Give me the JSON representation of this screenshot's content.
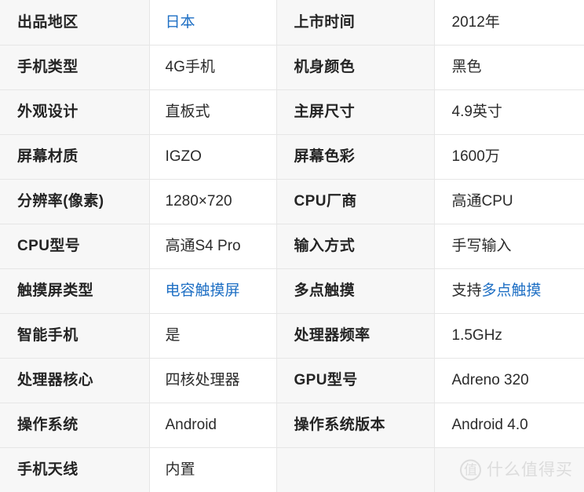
{
  "table": {
    "columns": 4,
    "accent_link_color": "#1e6fc4",
    "label_bg_color": "#f7f7f7",
    "value_bg_color": "#ffffff",
    "border_color": "#e6e6e6",
    "rows": [
      {
        "label_a": "出品地区",
        "value_a": "日本",
        "value_a_link": true,
        "label_b": "上市时间",
        "value_b": "2012年"
      },
      {
        "label_a": "手机类型",
        "value_a": "4G手机",
        "value_a_link": false,
        "label_b": "机身颜色",
        "value_b": "黑色"
      },
      {
        "label_a": "外观设计",
        "value_a": "直板式",
        "value_a_link": false,
        "label_b": "主屏尺寸",
        "value_b": "4.9英寸"
      },
      {
        "label_a": "屏幕材质",
        "value_a": "IGZO",
        "value_a_link": false,
        "label_b": "屏幕色彩",
        "value_b": "1600万"
      },
      {
        "label_a": "分辨率(像素)",
        "value_a": "1280×720",
        "value_a_link": false,
        "label_b": "CPU厂商",
        "value_b": "高通CPU"
      },
      {
        "label_a": "CPU型号",
        "value_a": "高通S4 Pro",
        "value_a_link": false,
        "label_b": "输入方式",
        "value_b": "手写输入"
      },
      {
        "label_a": "触摸屏类型",
        "value_a": "电容触摸屏",
        "value_a_link": true,
        "label_b": "多点触摸",
        "value_b_prefix": "支持",
        "value_b_link_text": "多点触摸"
      },
      {
        "label_a": "智能手机",
        "value_a": "是",
        "value_a_link": false,
        "label_b": "处理器频率",
        "value_b": "1.5GHz"
      },
      {
        "label_a": "处理器核心",
        "value_a": "四核处理器",
        "value_a_link": false,
        "label_b": "GPU型号",
        "value_b": "Adreno 320"
      },
      {
        "label_a": "操作系统",
        "value_a": "Android",
        "value_a_link": false,
        "label_b": "操作系统版本",
        "value_b": "Android 4.0"
      },
      {
        "label_a": "手机天线",
        "value_a": "内置",
        "value_a_link": false,
        "label_b": "",
        "value_b": ""
      }
    ]
  },
  "watermark": {
    "mark": "值",
    "text": "什么值得买",
    "color": "#dcdcdc"
  }
}
